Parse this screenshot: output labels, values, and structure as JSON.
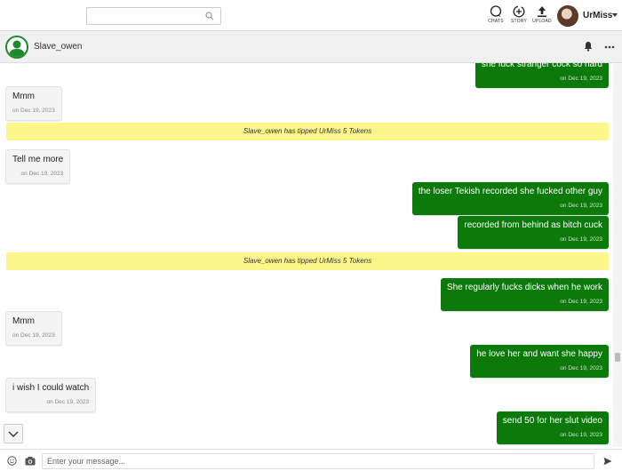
{
  "header": {
    "search": {
      "placeholder": ""
    },
    "nav": {
      "chats": "CHATS",
      "story": "STORY",
      "upload": "UPLOAD"
    },
    "username": "UrMiss"
  },
  "chat": {
    "peer_name": "Slave_owen"
  },
  "messages": [
    {
      "text": "she fuck stranger cock so hard",
      "date": "on Dec 19, 2023"
    },
    {
      "text": "Mmm",
      "date": "on Dec 19, 2023"
    },
    {
      "text": "Slave_owen has tipped UrMiss 5 Tokens"
    },
    {
      "text": "Tell me more",
      "date": "on Dec 19, 2023"
    },
    {
      "text": "the loser Tekish recorded she fucked other guy",
      "date": "on Dec 19, 2023"
    },
    {
      "text": "recorded from behind as bitch cuck",
      "date": "on Dec 19, 2023"
    },
    {
      "text": "Slave_owen has tipped UrMiss 5 Tokens"
    },
    {
      "text": "She regularly fucks dicks when he work",
      "date": "on Dec 19, 2023"
    },
    {
      "text": "Mmm",
      "date": "on Dec 19, 2023"
    },
    {
      "text": "he love her and want she happy",
      "date": "on Dec 19, 2023"
    },
    {
      "text": "i wish I could watch",
      "date": "on Dec 19, 2023"
    },
    {
      "text": "send 50 for her slut video",
      "date": "on Dec 19, 2023"
    }
  ],
  "composer": {
    "placeholder": "Enter your message..."
  },
  "colors": {
    "outgoing": "#0b7a0b",
    "incoming": "#f4f4f4",
    "tip": "#fdf68a",
    "accent": "#1e8a2e"
  }
}
